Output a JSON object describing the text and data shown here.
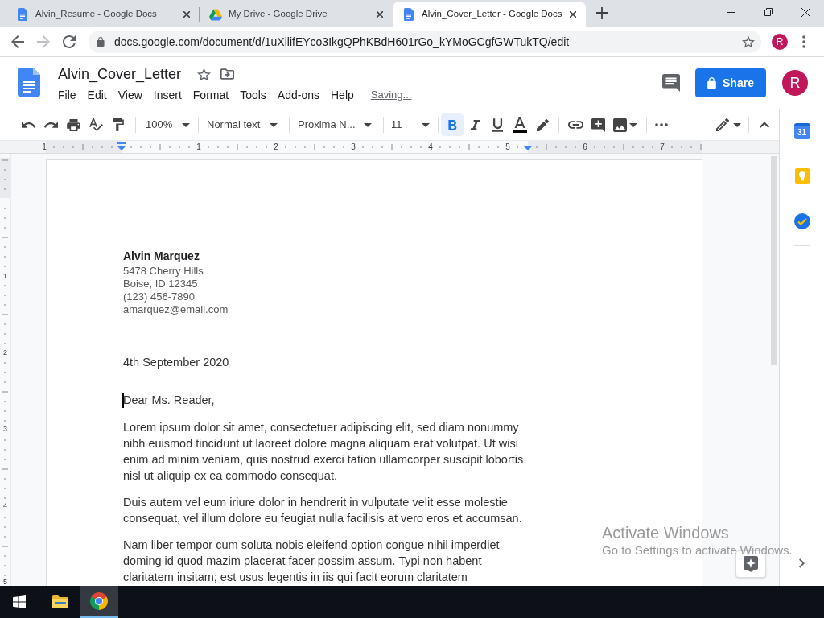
{
  "browser": {
    "tabs": [
      {
        "kind": "docs",
        "title": "Alvin_Resume - Google Docs",
        "selected": false
      },
      {
        "kind": "drive",
        "title": "My Drive - Google Drive",
        "selected": false
      },
      {
        "kind": "docs",
        "title": "Alvin_Cover_Letter - Google Docs",
        "selected": true
      }
    ],
    "nav_buttons": [
      {
        "kind": "back",
        "disabled": false
      },
      {
        "kind": "forward",
        "disabled": true
      },
      {
        "kind": "reload",
        "disabled": false
      }
    ],
    "url": "docs.google.com/document/d/1uXilifEYco3IkgQPhKBdH601rGo_kYMoGCgfGWTukTQ/edit",
    "profile_initial": "R"
  },
  "docs_header": {
    "title": "Alvin_Cover_Letter",
    "menu": [
      "File",
      "Edit",
      "View",
      "Insert",
      "Format",
      "Tools",
      "Add-ons",
      "Help"
    ],
    "save_status": "Saving...",
    "share_button": "Share",
    "account_initial": "R"
  },
  "toolbar": {
    "zoom": "100%",
    "paragraph_style": "Normal text",
    "font": "Proxima N...",
    "font_size": "11",
    "bold": true,
    "italic": false,
    "underline": false
  },
  "ruler": {
    "horizontal_numbers": [
      "1",
      "1",
      "2",
      "3",
      "4",
      "5",
      "6",
      "7"
    ],
    "vertical_numbers": [
      "1",
      "2",
      "3",
      "4",
      "5"
    ]
  },
  "document": {
    "sender_name": "Alvin Marquez",
    "sender_details": [
      "5478 Cherry Hills",
      "Boise, ID 12345",
      "(123) 456-7890",
      "amarquez@email.com"
    ],
    "date": "4th September 2020",
    "salutation": "Dear Ms. Reader,",
    "paragraphs": [
      "Lorem ipsum dolor sit amet, consectetuer adipiscing elit, sed diam nonummy nibh euismod tincidunt ut laoreet dolore magna aliquam erat volutpat. Ut wisi enim ad minim veniam, quis nostrud exerci tation ullamcorper suscipit lobortis nisl ut aliquip ex ea commodo consequat.",
      "Duis autem vel eum iriure dolor in hendrerit in vulputate velit esse molestie consequat, vel illum dolore eu feugiat nulla facilisis at vero eros et accumsan.",
      "Nam liber tempor cum soluta nobis eleifend option congue nihil imperdiet doming id quod mazim placerat facer possim assum. Typi non habent claritatem insitam; est usus legentis in iis qui facit eorum claritatem"
    ]
  },
  "side_panel": {
    "calendar_day": "31"
  },
  "activation_notice": {
    "title": "Activate Windows",
    "message": "Go to Settings to activate Windows."
  },
  "taskbar": {
    "apps": [
      {
        "kind": "file-explorer",
        "selected": false
      },
      {
        "kind": "chrome",
        "selected": true
      }
    ]
  }
}
